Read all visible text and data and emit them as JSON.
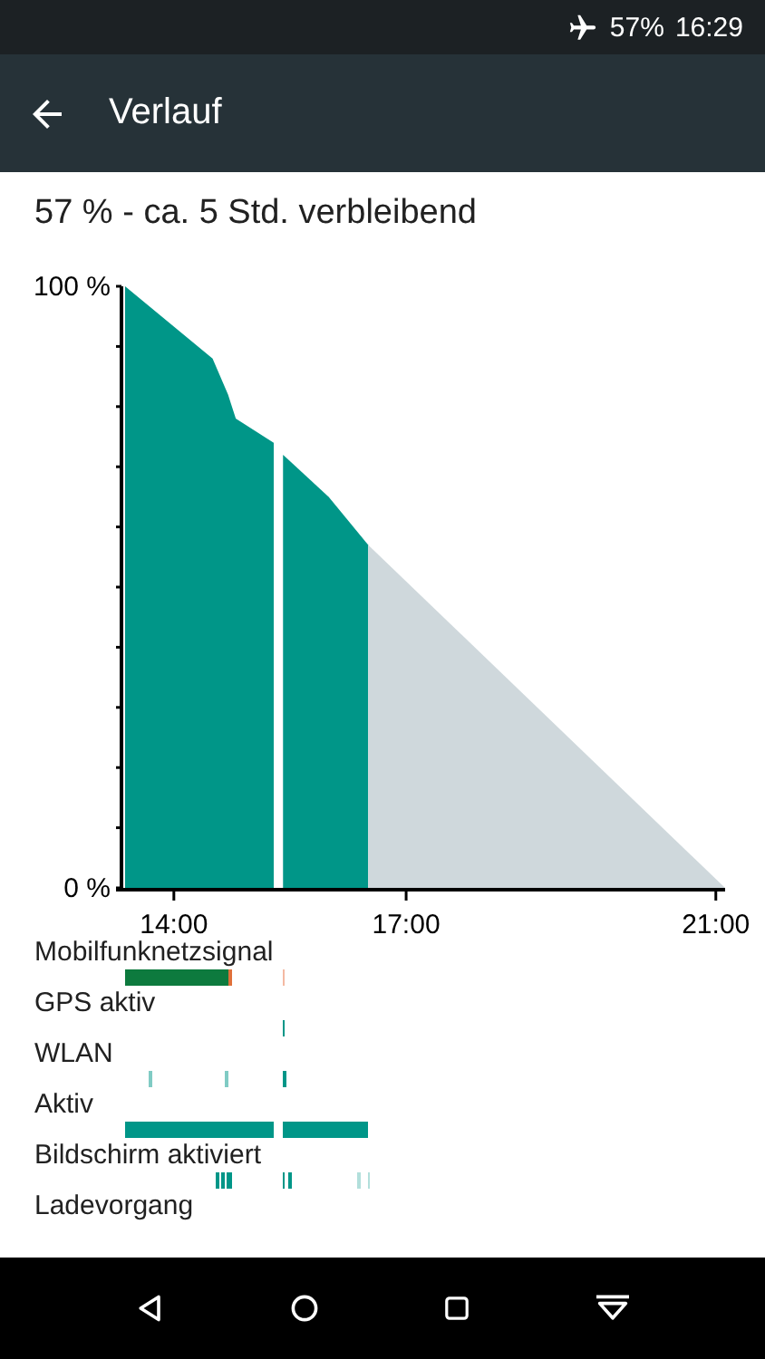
{
  "status_bar": {
    "battery": "57%",
    "time": "16:29"
  },
  "toolbar": {
    "title": "Verlauf"
  },
  "summary": "57 % - ca. 5 Std. verbleibend",
  "chart_data": {
    "type": "area",
    "x": [
      13.37,
      14.5,
      14.7,
      14.8,
      15.29,
      15.41,
      16.0,
      16.51,
      21.12
    ],
    "series": [
      {
        "color": "#009688",
        "values": [
          100,
          88,
          82,
          78,
          74,
          null,
          null,
          null,
          null
        ]
      },
      {
        "color": "#009688",
        "values": [
          null,
          null,
          null,
          null,
          null,
          72,
          65,
          57,
          null
        ]
      },
      {
        "color": "#cfd8dc",
        "values": [
          null,
          null,
          null,
          null,
          null,
          null,
          null,
          57,
          0
        ]
      }
    ],
    "ylim": [
      0,
      100
    ],
    "xlim": [
      13.37,
      21.12
    ],
    "yticks": [
      {
        "value": 0,
        "label": "0 %"
      },
      {
        "value": 100,
        "label": "100 %"
      }
    ],
    "xticks": [
      {
        "value": 14,
        "label": "14:00"
      },
      {
        "value": 17,
        "label": "17:00"
      },
      {
        "value": 21,
        "label": "21:00"
      }
    ]
  },
  "tracks": [
    {
      "label": "Mobilfunknetzsignal"
    },
    {
      "label": "GPS aktiv"
    },
    {
      "label": "WLAN"
    },
    {
      "label": "Aktiv"
    },
    {
      "label": "Bildschirm aktiviert"
    },
    {
      "label": "Ladevorgang"
    }
  ],
  "nav_bar": {
    "buttons": [
      {
        "kind": "back"
      },
      {
        "kind": "home"
      },
      {
        "kind": "recents"
      },
      {
        "kind": "collapse"
      }
    ]
  }
}
